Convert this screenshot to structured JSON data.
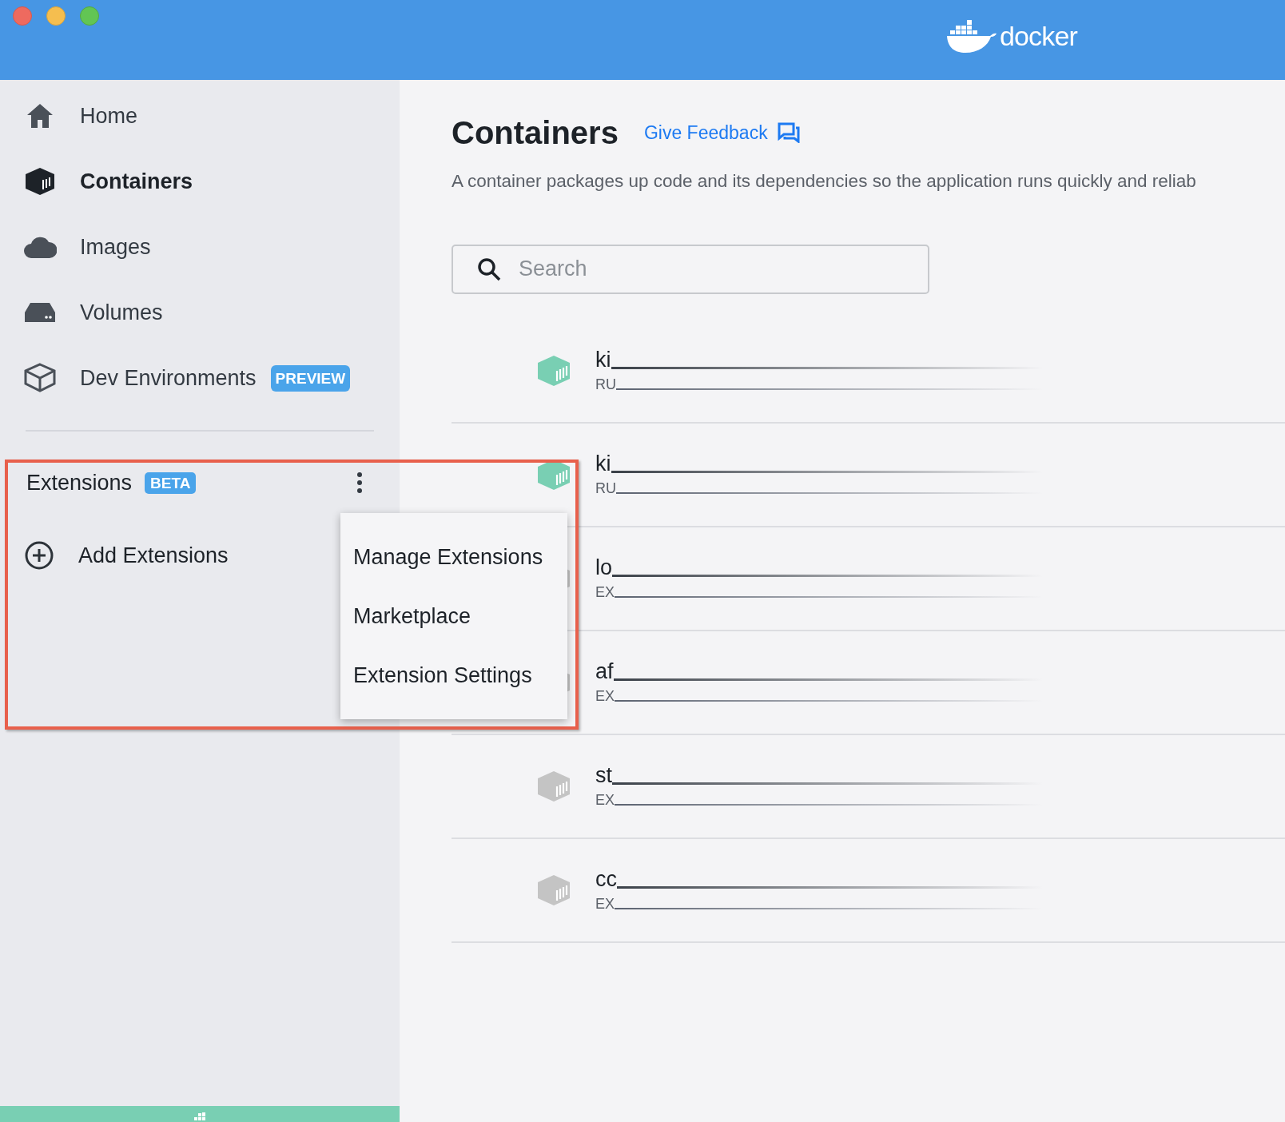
{
  "window": {
    "brand": "docker"
  },
  "sidebar": {
    "items": [
      {
        "label": "Home",
        "selected": false
      },
      {
        "label": "Containers",
        "selected": true
      },
      {
        "label": "Images",
        "selected": false
      },
      {
        "label": "Volumes",
        "selected": false
      },
      {
        "label": "Dev Environments",
        "selected": false,
        "badge": "PREVIEW"
      }
    ],
    "extensions": {
      "title": "Extensions",
      "badge": "BETA",
      "add_label": "Add Extensions"
    },
    "menu": [
      "Manage Extensions",
      "Marketplace",
      "Extension Settings"
    ]
  },
  "main": {
    "title": "Containers",
    "feedback": "Give Feedback",
    "description": "A container packages up code and its dependencies so the application runs quickly and reliab",
    "search": {
      "placeholder": "Search"
    }
  },
  "containers": [
    {
      "name": "ki",
      "status": "RU",
      "running": true
    },
    {
      "name": "ki",
      "status": "RU",
      "running": true
    },
    {
      "name": "lo",
      "status": "EX",
      "running": false
    },
    {
      "name": "af",
      "status": "EX",
      "running": false
    },
    {
      "name": "st",
      "status": "EX",
      "running": false
    },
    {
      "name": "cc",
      "status": "EX",
      "running": false
    }
  ]
}
